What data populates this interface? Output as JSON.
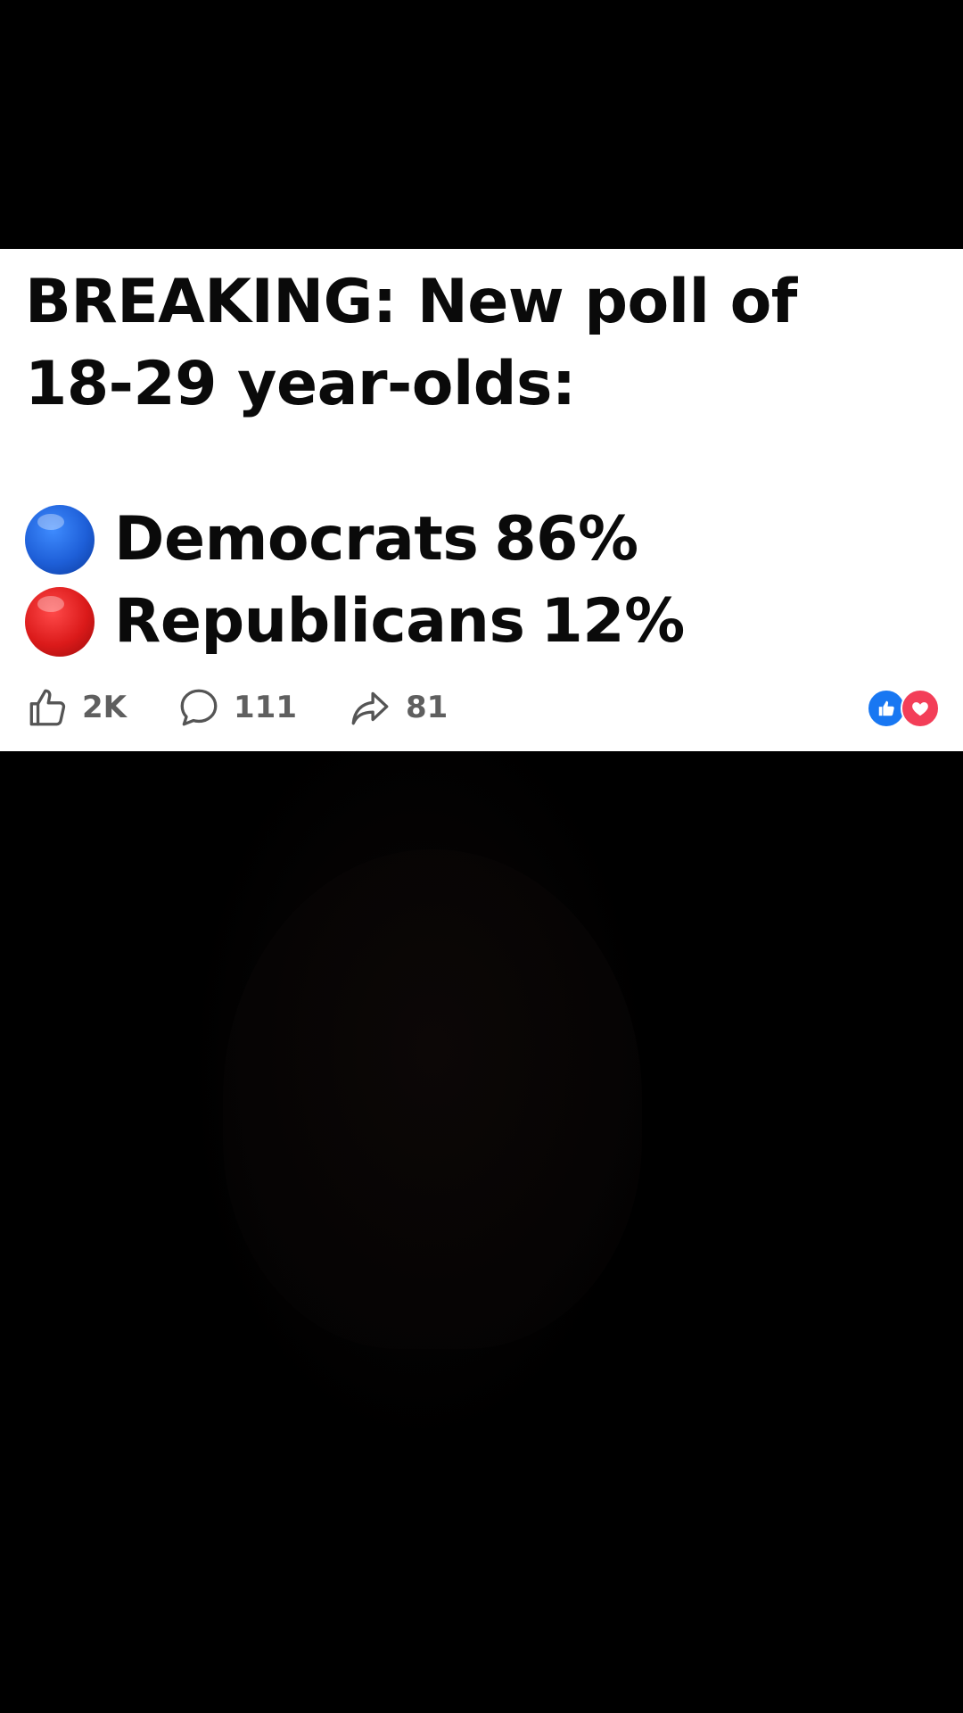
{
  "post": {
    "headline_line1": "BREAKING: New poll of",
    "headline_line2": "18-29 year-olds:",
    "poll": [
      {
        "party": "Democrats",
        "percent": "86%",
        "dot_color": "#1e5fd8",
        "icon": "blue-circle-icon"
      },
      {
        "party": "Republicans",
        "percent": "12%",
        "dot_color": "#db1a1a",
        "icon": "red-circle-icon"
      }
    ]
  },
  "actions": {
    "likes": "2K",
    "comments": "111",
    "shares": "81"
  },
  "reactions": {
    "like_color": "#1877f2",
    "love_color": "#f33e58",
    "icons": [
      "like-reaction-icon",
      "love-reaction-icon"
    ]
  }
}
